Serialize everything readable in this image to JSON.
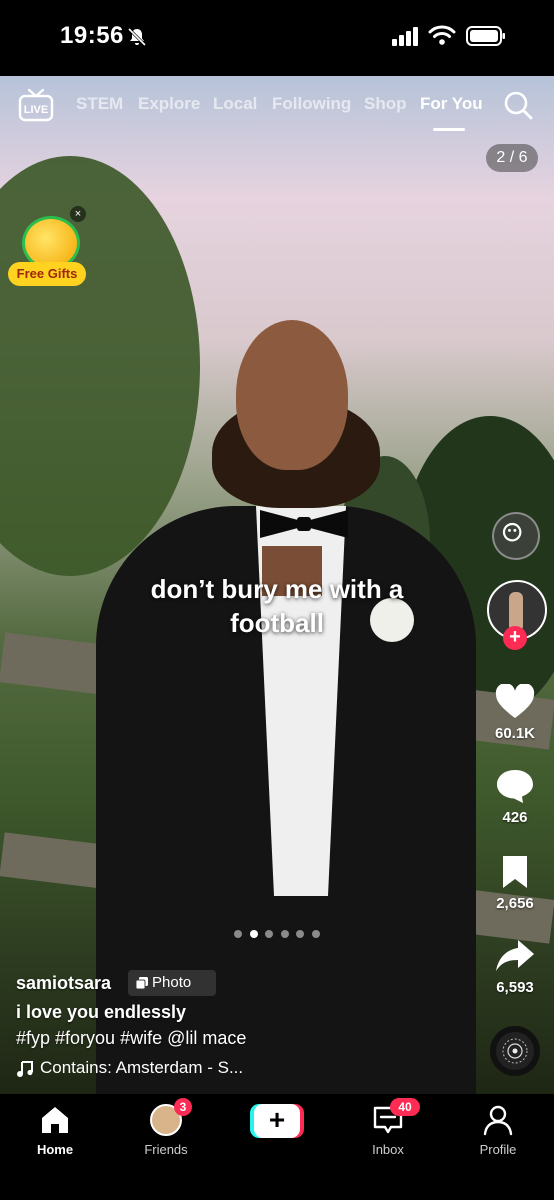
{
  "status_bar": {
    "time": "19:56"
  },
  "top_nav": {
    "live_label": "LIVE",
    "tabs": [
      "STEM",
      "Explore",
      "Local",
      "Following",
      "Shop",
      "For You"
    ],
    "active_tab": "For You"
  },
  "photo_counter": "2 / 6",
  "promo": {
    "label": "Free Gifts",
    "close": "×"
  },
  "post": {
    "overlay_text_line1": "don’t bury me with a",
    "overlay_text_line2": "football",
    "author": "samiotsara",
    "type_badge": "Photo",
    "caption": "i love you endlessly",
    "hashtags": "#fyp #foryou #wife @lil mace",
    "music": "Contains: Amsterdam - S..."
  },
  "actions": {
    "likes": "60.1K",
    "comments": "426",
    "saves": "2,656",
    "shares": "6,593"
  },
  "carousel": {
    "total": 6,
    "active_index": 1
  },
  "bottom_nav": {
    "home": "Home",
    "friends": "Friends",
    "friends_badge": "3",
    "inbox": "Inbox",
    "inbox_badge": "40",
    "profile": "Profile",
    "add_symbol": "+"
  },
  "colors": {
    "accent": "#fe2c55",
    "gift_label_bg": "#ffd21f"
  }
}
